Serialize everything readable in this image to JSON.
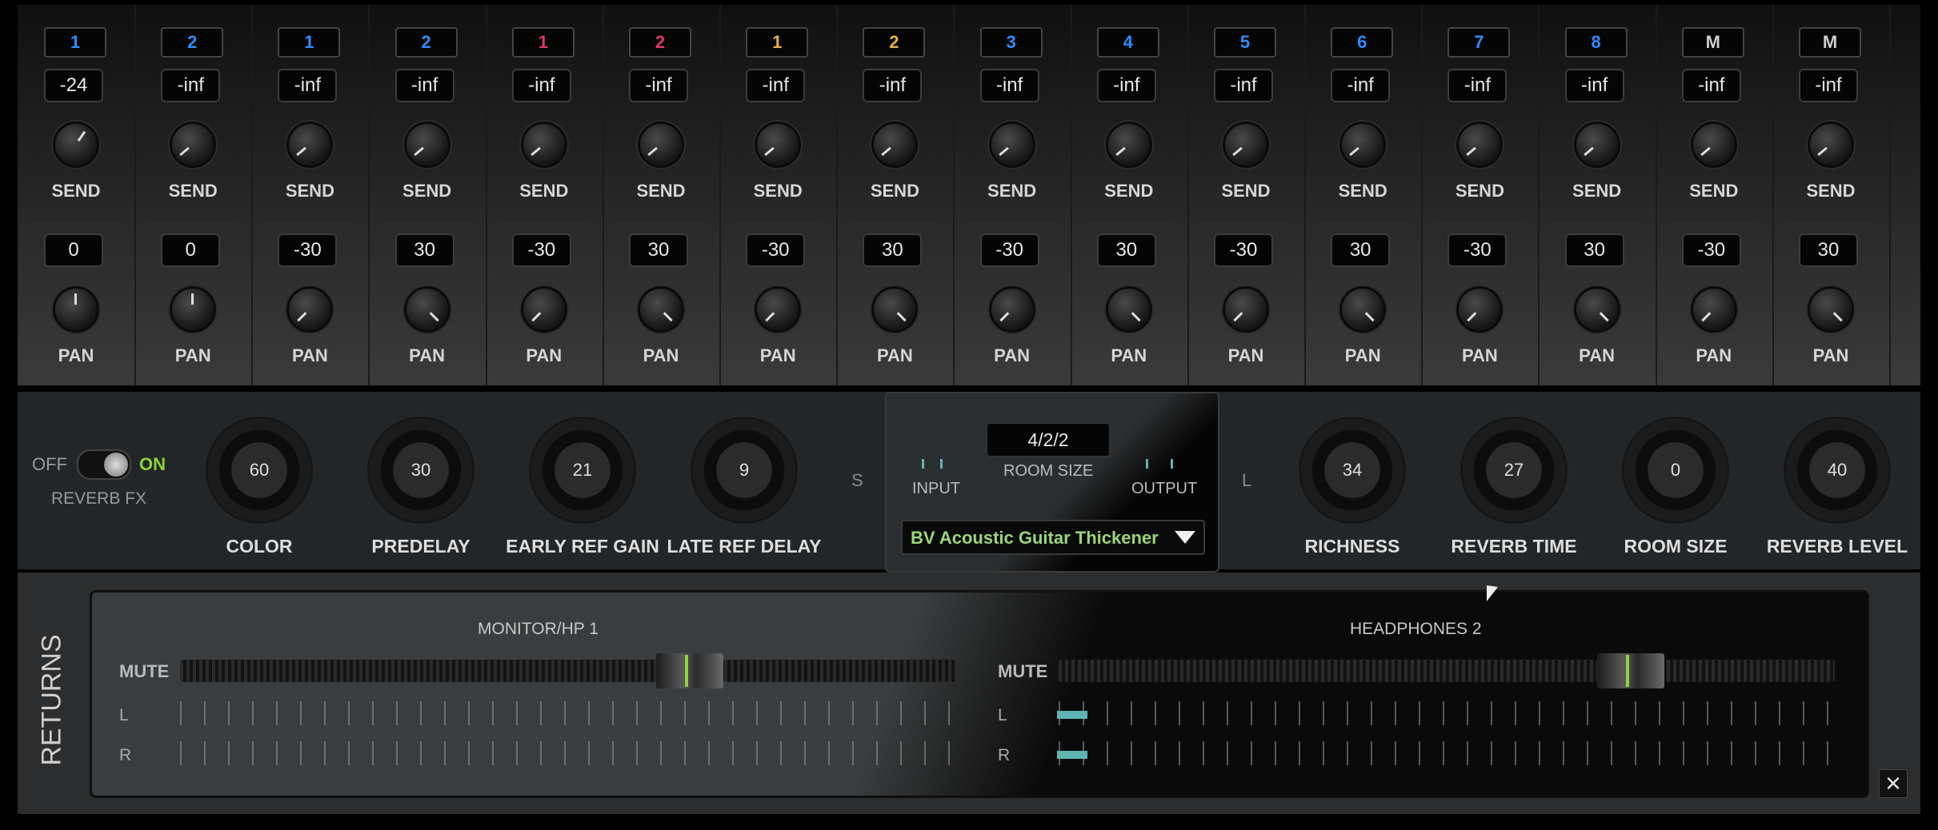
{
  "channels": [
    {
      "num": "1",
      "num_color": "#2f8cff",
      "gain": "-24",
      "pan": "0"
    },
    {
      "num": "2",
      "num_color": "#2f8cff",
      "gain": "-inf",
      "pan": "0"
    },
    {
      "num": "1",
      "num_color": "#2f8cff",
      "gain": "-inf",
      "pan": "-30"
    },
    {
      "num": "2",
      "num_color": "#2f8cff",
      "gain": "-inf",
      "pan": "30"
    },
    {
      "num": "1",
      "num_color": "#e0356f",
      "gain": "-inf",
      "pan": "-30"
    },
    {
      "num": "2",
      "num_color": "#e0356f",
      "gain": "-inf",
      "pan": "30"
    },
    {
      "num": "1",
      "num_color": "#e6b04a",
      "gain": "-inf",
      "pan": "-30"
    },
    {
      "num": "2",
      "num_color": "#e6b04a",
      "gain": "-inf",
      "pan": "30"
    },
    {
      "num": "3",
      "num_color": "#2f8cff",
      "gain": "-inf",
      "pan": "-30"
    },
    {
      "num": "4",
      "num_color": "#2f8cff",
      "gain": "-inf",
      "pan": "30"
    },
    {
      "num": "5",
      "num_color": "#2f8cff",
      "gain": "-inf",
      "pan": "-30"
    },
    {
      "num": "6",
      "num_color": "#2f8cff",
      "gain": "-inf",
      "pan": "30"
    },
    {
      "num": "7",
      "num_color": "#2f8cff",
      "gain": "-inf",
      "pan": "-30"
    },
    {
      "num": "8",
      "num_color": "#2f8cff",
      "gain": "-inf",
      "pan": "30"
    },
    {
      "num": "M",
      "num_color": "#d0d0d0",
      "gain": "-inf",
      "pan": "-30"
    },
    {
      "num": "M",
      "num_color": "#d0d0d0",
      "gain": "-inf",
      "pan": "30"
    }
  ],
  "strip_labels": {
    "send": "SEND",
    "pan": "PAN"
  },
  "reverb": {
    "off": "OFF",
    "on": "ON",
    "fx_label": "REVERB FX",
    "knobs_left": [
      {
        "label": "COLOR",
        "value": "60"
      },
      {
        "label": "PREDELAY",
        "value": "30"
      },
      {
        "label": "EARLY REF GAIN",
        "value": "21"
      },
      {
        "label": "LATE REF DELAY",
        "value": "9"
      }
    ],
    "s": "S",
    "l": "L",
    "room_display": "4/2/2",
    "room_size_label": "ROOM SIZE",
    "input_label": "INPUT",
    "output_label": "OUTPUT",
    "preset": "BV Acoustic Guitar Thickener",
    "knobs_right": [
      {
        "label": "RICHNESS",
        "value": "34"
      },
      {
        "label": "REVERB TIME",
        "value": "27"
      },
      {
        "label": "ROOM SIZE",
        "value": "0"
      },
      {
        "label": "REVERB LEVEL",
        "value": "40"
      }
    ]
  },
  "returns": {
    "title": "RETURNS",
    "left": {
      "name": "MONITOR/HP 1",
      "mute": "MUTE",
      "l": "L",
      "r": "R",
      "level": 0.67
    },
    "right": {
      "name": "HEADPHONES 2",
      "mute": "MUTE",
      "l": "L",
      "r": "R",
      "level": 0.76
    },
    "close_icon": "close-icon"
  }
}
